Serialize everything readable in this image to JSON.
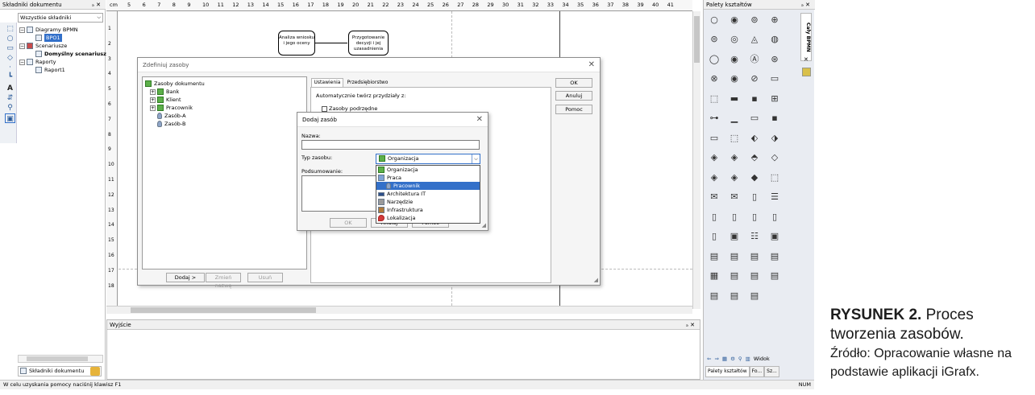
{
  "left_panel": {
    "title": "Składniki dokumentu",
    "pin": "ₔ ✕",
    "filter": "Wszystkie składniki",
    "tree": [
      {
        "label": "Diagramy BPMN",
        "level": 0
      },
      {
        "label": "BPO1",
        "level": 2,
        "selected": true
      },
      {
        "label": "Scenariusze",
        "level": 0
      },
      {
        "label": "Domyślny scenariusz",
        "level": 2,
        "bold": true
      },
      {
        "label": "Raporty",
        "level": 0
      },
      {
        "label": "Raport1",
        "level": 2
      }
    ],
    "bottom_tab": "Składniki dokumentu"
  },
  "ruler": {
    "unit": "cm",
    "ticks": [
      "5",
      "6",
      "7",
      "8",
      "9",
      "10",
      "11",
      "12",
      "13",
      "14",
      "15",
      "16",
      "17",
      "18",
      "19",
      "20",
      "21",
      "22",
      "23",
      "24",
      "25",
      "26",
      "27",
      "28",
      "29",
      "30",
      "31",
      "32",
      "33",
      "34",
      "35",
      "36",
      "37",
      "38",
      "39",
      "40",
      "41"
    ],
    "vticks": [
      "1",
      "2",
      "3",
      "4",
      "5",
      "6",
      "7",
      "8",
      "9",
      "10",
      "11",
      "12",
      "13",
      "14",
      "15",
      "16",
      "17",
      "18"
    ]
  },
  "canvas": {
    "shape1": "Analiza wniosku i jego oceny",
    "shape2": "Przygotowanie decyzji i jej uzasadnienia"
  },
  "define_dialog": {
    "title": "Zdefiniuj zasoby",
    "tree": [
      {
        "label": "Zasoby dokumentu",
        "level": 0
      },
      {
        "label": "Bank",
        "level": 1
      },
      {
        "label": "Klient",
        "level": 1
      },
      {
        "label": "Pracownik",
        "level": 1
      },
      {
        "label": "Zasób-A",
        "level": 1
      },
      {
        "label": "Zasób-B",
        "level": 1
      }
    ],
    "tabs": [
      "Ustawienia",
      "Przedsiębiorstwo"
    ],
    "auto_label": "Automatycznie twórz przydziały z:",
    "checkbox": "Zasoby podrzędne",
    "ok": "OK",
    "cancel": "Anuluj",
    "help": "Pomoc",
    "add": "Dodaj >",
    "rename": "Zmień nazwę",
    "delete": "Usuń"
  },
  "add_dialog": {
    "title": "Dodaj zasób",
    "name_label": "Nazwa:",
    "type_label": "Typ zasobu:",
    "type_value": "Organizacja",
    "summary_label": "Podsumowanie:",
    "options": [
      {
        "label": "Organizacja",
        "level": 0
      },
      {
        "label": "Praca",
        "level": 0
      },
      {
        "label": "Pracownik",
        "level": 1,
        "selected": true
      },
      {
        "label": "Architektura IT",
        "level": 0
      },
      {
        "label": "Narzędzie",
        "level": 0
      },
      {
        "label": "Infrastruktura",
        "level": 0
      },
      {
        "label": "Lokalizacja",
        "level": 0
      }
    ],
    "ok": "OK",
    "cancel": "Anuluj",
    "help": "Pomoc"
  },
  "output_panel": {
    "title": "Wyjście",
    "pin": "ₔ ✕"
  },
  "palette": {
    "title": "Palety kształtów",
    "pin": "ₔ ✕",
    "side_label": "Cały BPMN",
    "footer_label": "Widok",
    "tabs": [
      "Palety kształtów",
      "Fo...",
      "Sz..."
    ]
  },
  "status": {
    "left": "W celu uzyskania pomocy naciśnij klawisz F1",
    "right": "NUM"
  },
  "caption": {
    "label": "RYSUNEK 2.",
    "title": " Proces tworzenia zasobów.",
    "source": "Źródło: Opracowanie własne na podstawie aplikacji iGrafx."
  },
  "colors": {
    "accent": "#3370c9",
    "palette_bg": "#e9ecf2"
  }
}
